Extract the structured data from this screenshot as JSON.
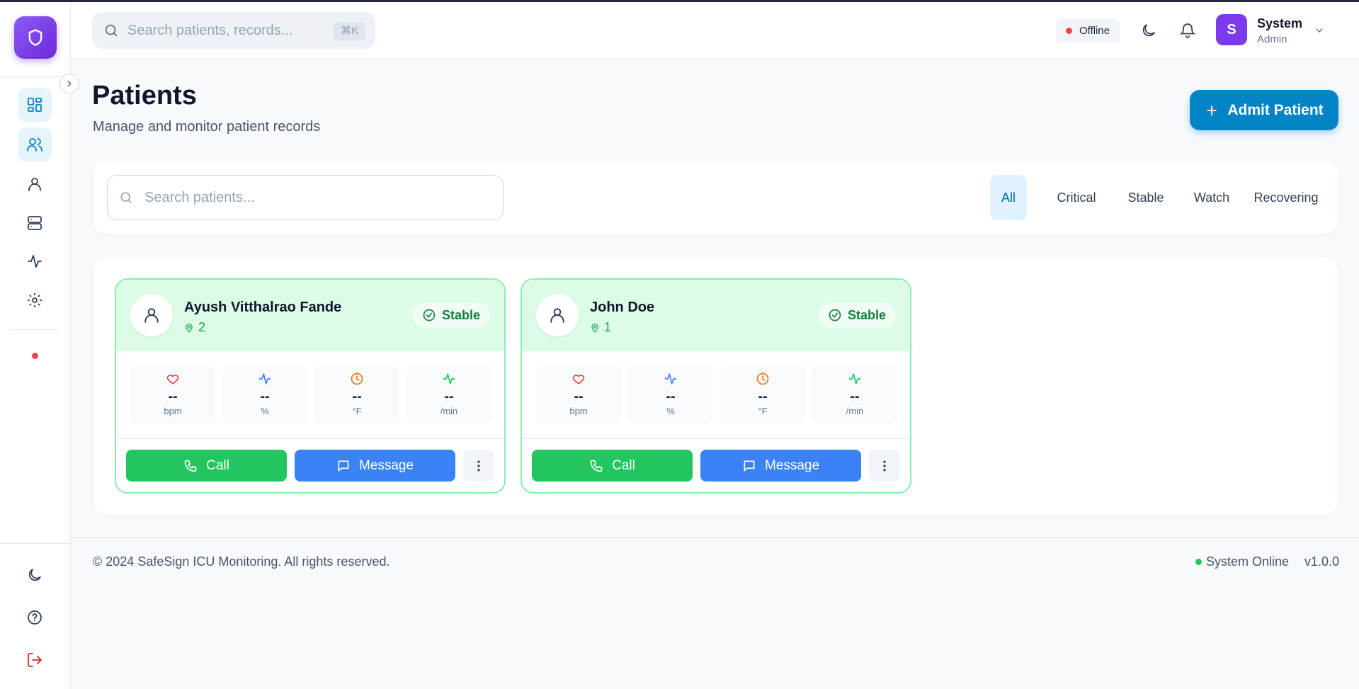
{
  "header": {
    "search_placeholder": "Search patients, records...",
    "search_shortcut": "⌘K",
    "connection_status": "Offline",
    "user": {
      "initial": "S",
      "name": "System",
      "role": "Admin"
    }
  },
  "page": {
    "title": "Patients",
    "subtitle": "Manage and monitor patient records",
    "admit_label": "Admit Patient"
  },
  "filters": {
    "search_placeholder": "Search patients...",
    "tabs": [
      "All",
      "Critical",
      "Stable",
      "Watch",
      "Recovering"
    ],
    "active_tab": "All"
  },
  "patients": [
    {
      "name": "Ayush Vitthalrao Fande",
      "bed": "2",
      "status": "Stable",
      "vitals": [
        {
          "icon": "heart-icon",
          "value": "--",
          "unit": "bpm"
        },
        {
          "icon": "activity-icon",
          "value": "--",
          "unit": "%"
        },
        {
          "icon": "clock-icon",
          "value": "--",
          "unit": "°F"
        },
        {
          "icon": "pulse-icon",
          "value": "--",
          "unit": "/min"
        }
      ]
    },
    {
      "name": "John Doe",
      "bed": "1",
      "status": "Stable",
      "vitals": [
        {
          "icon": "heart-icon",
          "value": "--",
          "unit": "bpm"
        },
        {
          "icon": "activity-icon",
          "value": "--",
          "unit": "%"
        },
        {
          "icon": "clock-icon",
          "value": "--",
          "unit": "°F"
        },
        {
          "icon": "pulse-icon",
          "value": "--",
          "unit": "/min"
        }
      ]
    }
  ],
  "actions": {
    "call_label": "Call",
    "message_label": "Message"
  },
  "footer": {
    "copyright": "© 2024 SafeSign ICU Monitoring. All rights reserved.",
    "system_status": "System Online",
    "version": "v1.0.0"
  },
  "colors": {
    "primary": "#0284c7",
    "stable": "#22c55e",
    "message": "#3b82f6",
    "avatar": "#7c3aed"
  }
}
